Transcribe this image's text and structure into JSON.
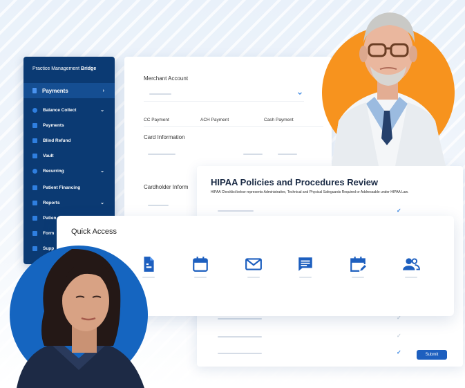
{
  "sidebar": {
    "brand_regular": "Practice Management ",
    "brand_bold": "Bridge",
    "main_label": "Payments",
    "items": [
      {
        "label": "Balance Collect"
      },
      {
        "label": "Payments"
      },
      {
        "label": "Blind Refund"
      },
      {
        "label": "Vault"
      },
      {
        "label": "Recurring"
      },
      {
        "label": "Patient Financing"
      },
      {
        "label": "Reports"
      },
      {
        "label": "Patien"
      },
      {
        "label": "Form"
      },
      {
        "label": "Supp"
      }
    ],
    "chevron": "›",
    "expand": "⌄"
  },
  "payment": {
    "merchant_label": "Merchant Account",
    "tabs": [
      "CC Payment",
      "ACH Payment",
      "Cash Payment"
    ],
    "card_info_label": "Card Information",
    "cardholder_label": "Cardholder Inform"
  },
  "hipaa": {
    "title": "HIPAA Policies and Procedures Review",
    "description": "HIPAA Checklist below represents Administrative, Technical and Physical Safeguards Required or Addressable under HIPAA Law.",
    "submit_label": "Submit",
    "check_glyph": "✓"
  },
  "quick_access": {
    "title": "Quick Access",
    "icons": [
      "document-icon",
      "calendar-icon",
      "mail-icon",
      "message-icon",
      "calendar-edit-icon",
      "users-icon"
    ]
  },
  "colors": {
    "sidebar_bg": "#0b3a73",
    "accent": "#2f7fe0",
    "orange": "#f7931e",
    "blue_circle": "#1565c0",
    "submit": "#1d5fbf"
  }
}
